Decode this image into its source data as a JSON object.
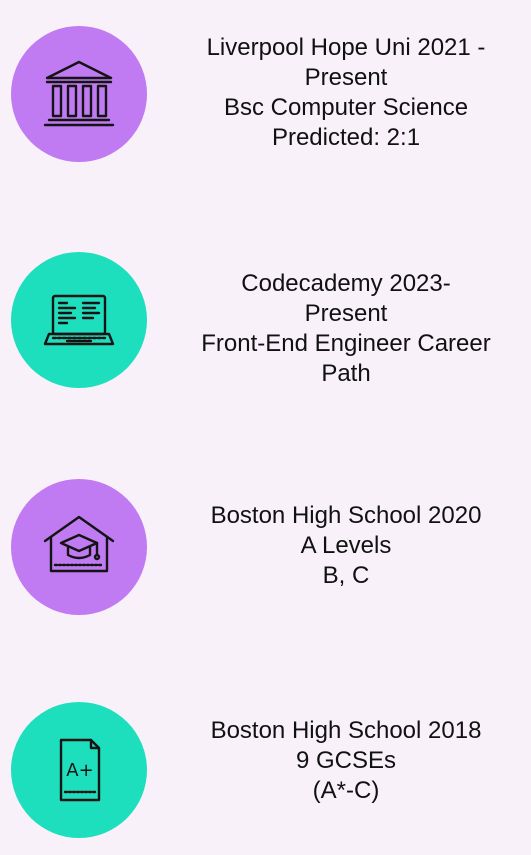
{
  "colors": {
    "background": "#f8f1fa",
    "purple": "#c07af2",
    "teal": "#1edfbd",
    "icon_stroke": "#141414"
  },
  "entries": [
    {
      "icon": "university-building-icon",
      "circle_color": "purple",
      "lines": [
        "Liverpool Hope Uni 2021 -",
        "Present",
        "Bsc Computer Science",
        "Predicted: 2:1"
      ]
    },
    {
      "icon": "laptop-icon",
      "circle_color": "teal",
      "lines": [
        "Codecademy 2023-",
        "Present",
        "Front-End Engineer Career",
        "Path"
      ]
    },
    {
      "icon": "school-graduation-cap-icon",
      "circle_color": "purple",
      "lines": [
        "Boston High School 2020",
        "A Levels",
        "B, C"
      ]
    },
    {
      "icon": "grade-document-icon",
      "circle_color": "teal",
      "lines": [
        "Boston High School 2018",
        "9 GCSEs",
        "(A*-C)"
      ]
    }
  ],
  "grade_document_text": "A+"
}
